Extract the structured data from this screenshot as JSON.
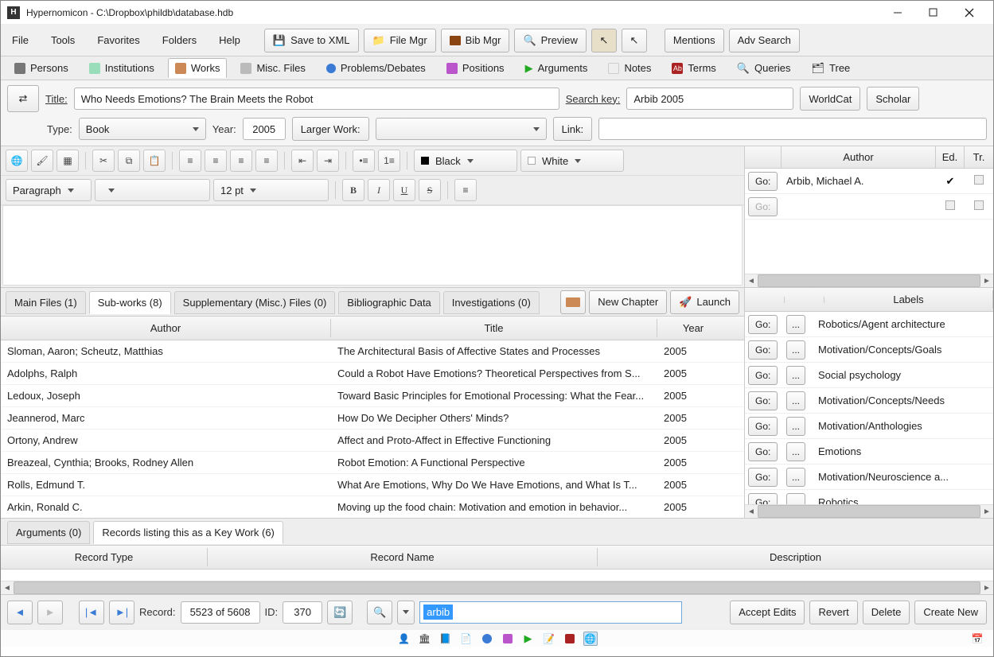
{
  "titlebar": {
    "text": "Hypernomicon - C:\\Dropbox\\phildb\\database.hdb"
  },
  "menu": {
    "file": "File",
    "tools": "Tools",
    "favorites": "Favorites",
    "folders": "Folders",
    "help": "Help"
  },
  "toolbar": {
    "save_xml": "Save to XML",
    "file_mgr": "File Mgr",
    "bib_mgr": "Bib Mgr",
    "preview": "Preview",
    "mentions": "Mentions",
    "adv_search": "Adv Search"
  },
  "tabs": {
    "persons": "Persons",
    "institutions": "Institutions",
    "works": "Works",
    "misc": "Misc. Files",
    "problems": "Problems/Debates",
    "positions": "Positions",
    "arguments": "Arguments",
    "notes": "Notes",
    "terms": "Terms",
    "queries": "Queries",
    "tree": "Tree"
  },
  "fields": {
    "title_label": "Title:",
    "title_value": "Who Needs Emotions? The Brain Meets the Robot",
    "searchkey_label": "Search key:",
    "searchkey_value": "Arbib 2005",
    "worldcat": "WorldCat",
    "scholar": "Scholar",
    "type_label": "Type:",
    "type_value": "Book",
    "year_label": "Year:",
    "year_value": "2005",
    "larger_work": "Larger Work:",
    "link": "Link:"
  },
  "editor": {
    "color_black": "Black",
    "color_white": "White",
    "para": "Paragraph",
    "font_size": "12 pt",
    "bold": "B",
    "italic": "I",
    "underline": "U",
    "strike": "S"
  },
  "authors": {
    "header_author": "Author",
    "header_ed": "Ed.",
    "header_tr": "Tr.",
    "go": "Go:",
    "rows": [
      {
        "name": "Arbib, Michael A.",
        "ed": true,
        "tr": false
      },
      {
        "name": "",
        "ed": false,
        "tr": false
      }
    ]
  },
  "subtabs": {
    "main_files": "Main Files (1)",
    "sub_works": "Sub-works (8)",
    "supp": "Supplementary (Misc.) Files (0)",
    "bib": "Bibliographic Data",
    "inv": "Investigations (0)",
    "new_chapter": "New Chapter",
    "launch": "Launch"
  },
  "subtable": {
    "h_author": "Author",
    "h_title": "Title",
    "h_year": "Year",
    "rows": [
      {
        "author": "Sloman, Aaron; Scheutz, Matthias",
        "title": "The Architectural Basis of Affective States and Processes",
        "year": "2005"
      },
      {
        "author": "Adolphs, Ralph",
        "title": "Could a Robot Have Emotions? Theoretical Perspectives from S...",
        "year": "2005"
      },
      {
        "author": "Ledoux, Joseph",
        "title": "Toward Basic Principles for Emotional Processing: What the Fear...",
        "year": "2005"
      },
      {
        "author": "Jeannerod, Marc",
        "title": "How Do We Decipher Others' Minds?",
        "year": "2005"
      },
      {
        "author": "Ortony, Andrew",
        "title": "Affect and Proto-Affect in Effective Functioning",
        "year": "2005"
      },
      {
        "author": "Breazeal, Cynthia; Brooks, Rodney Allen",
        "title": "Robot Emotion: A Functional Perspective",
        "year": "2005"
      },
      {
        "author": "Rolls, Edmund T.",
        "title": "What Are Emotions, Why Do We Have Emotions, and What Is T...",
        "year": "2005"
      },
      {
        "author": "Arkin, Ronald C.",
        "title": "Moving up the food chain: Motivation and emotion in behavior...",
        "year": "2005"
      }
    ]
  },
  "labels": {
    "header": "Labels",
    "go": "Go:",
    "dd": "...",
    "rows": [
      "Robotics/Agent architecture",
      "Motivation/Concepts/Goals",
      "Social psychology",
      "Motivation/Concepts/Needs",
      "Motivation/Anthologies",
      "Emotions",
      "Motivation/Neuroscience a...",
      "Robotics"
    ]
  },
  "bottom_tabs": {
    "arguments": "Arguments (0)",
    "records": "Records listing this as a Key Work (6)"
  },
  "records_header": {
    "type": "Record Type",
    "name": "Record Name",
    "desc": "Description"
  },
  "footer": {
    "back": "◄",
    "fwd": "►",
    "first": "⏮",
    "last": "⏭",
    "record_label": "Record:",
    "record_value": "5523 of 5608",
    "id_label": "ID:",
    "id_value": "370",
    "search_value": "arbib",
    "accept": "Accept Edits",
    "revert": "Revert",
    "delete": "Delete",
    "create_new": "Create New"
  }
}
